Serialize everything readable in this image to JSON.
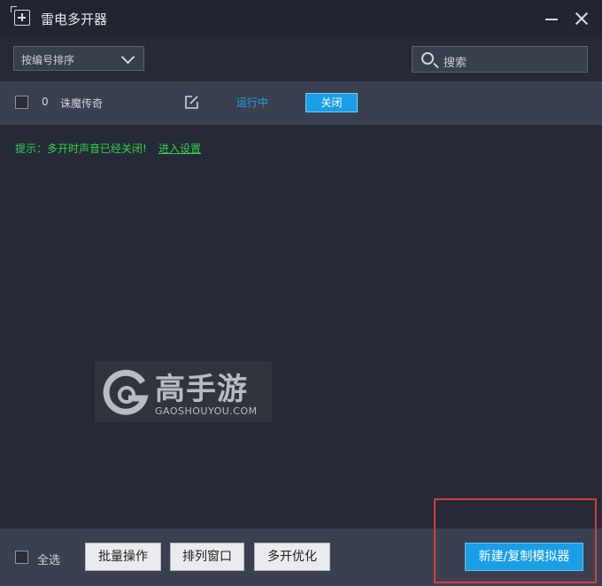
{
  "window": {
    "title": "雷电多开器"
  },
  "toolbar": {
    "sort_label": "按编号排序",
    "search_placeholder": "搜索"
  },
  "instances": [
    {
      "index": "0",
      "name": "诛魔传奇",
      "status": "运行中",
      "close_label": "关闭"
    }
  ],
  "tip": {
    "text": "提示：多开时声音已经关闭!",
    "link": "进入设置"
  },
  "watermark": {
    "cn": "高手游",
    "en": "GAOSHOUYOU.COM"
  },
  "bottom": {
    "select_all": "全选",
    "batch_label": "批量操作",
    "arrange_label": "排列窗口",
    "optimize_label": "多开优化",
    "new_label": "新建/复制模拟器"
  },
  "colors": {
    "accent": "#1a9ee5",
    "tip": "#2fd14a",
    "highlight": "#d93a3a",
    "background": "#262a37"
  },
  "icons": [
    "app-icon",
    "minimize-icon",
    "close-icon",
    "chevron-down-icon",
    "search-icon",
    "edit-icon",
    "gaoshouyou-logo"
  ]
}
